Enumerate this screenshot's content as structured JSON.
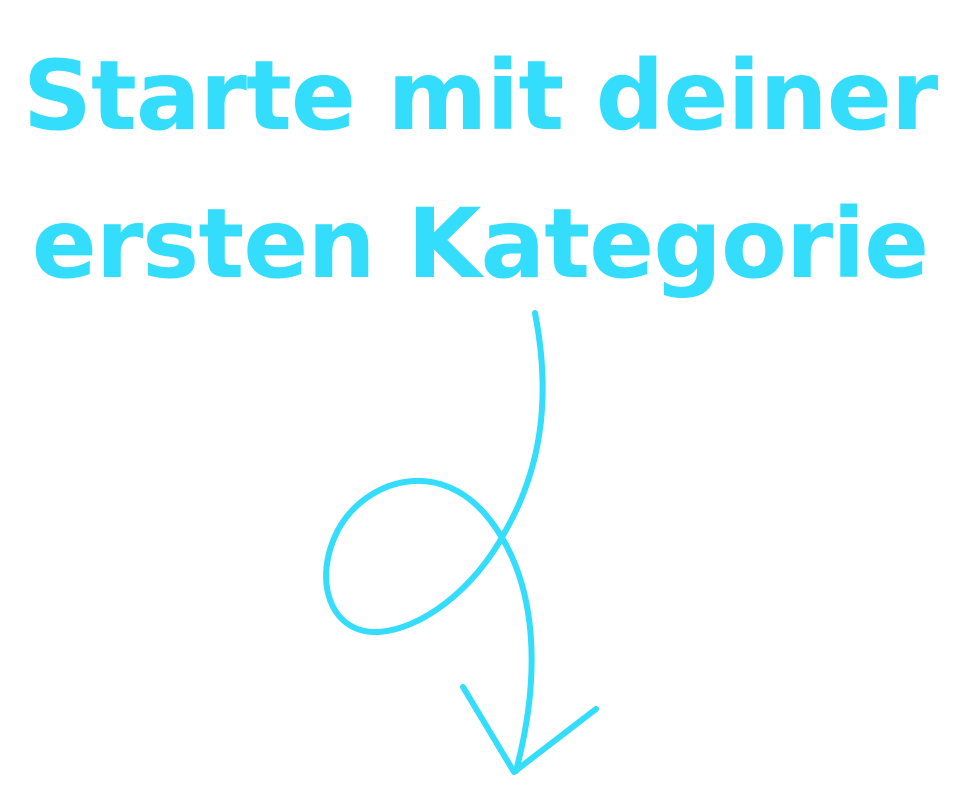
{
  "empty_state": {
    "headline_line_1": "Starte mit deiner",
    "headline_line_2": "ersten Kategorie",
    "accent_color": "#33ddfb",
    "background_color": "#ffffff",
    "arrow_icon": "hand-drawn-loop-arrow-down-icon"
  }
}
